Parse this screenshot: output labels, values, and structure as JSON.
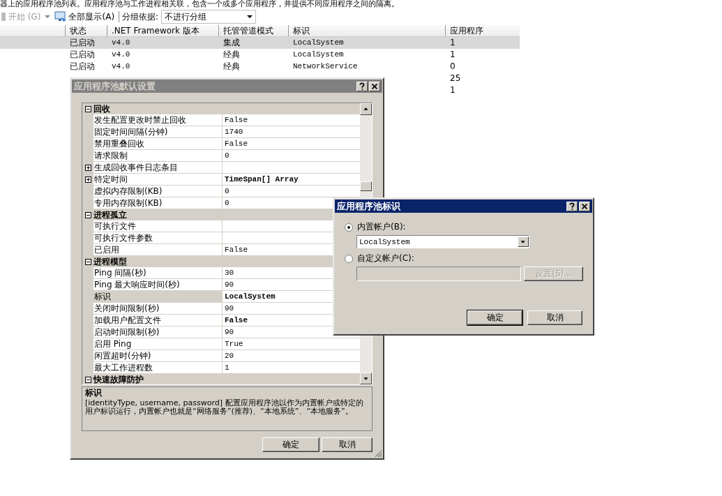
{
  "description_line": "器上的应用程序池列表。应用程序池与工作进程相关联，包含一个或多个应用程序，并提供不同应用程序之间的隔离。",
  "toolbar": {
    "items": [
      {
        "kind": "start",
        "label": "开始 (G)",
        "disabled": true
      },
      {
        "kind": "show-all",
        "label": "全部显示(A)",
        "disabled": false
      }
    ],
    "group_label": "分组依据:",
    "group_value": "不进行分组"
  },
  "table": {
    "columns": [
      "状态",
      ".NET Framework 版本",
      "托管管道模式",
      "标识",
      "应用程序"
    ],
    "rows": [
      {
        "cells": [
          "已启动",
          "v4.0",
          "集成",
          "LocalSystem",
          "1"
        ],
        "selected": true
      },
      {
        "cells": [
          "已启动",
          "v4.0",
          "经典",
          "LocalSystem",
          "1"
        ],
        "selected": false
      },
      {
        "cells": [
          "已启动",
          "v4.0",
          "经典",
          "NetworkService",
          "0"
        ],
        "selected": false
      },
      {
        "apps": "25",
        "selected": false
      },
      {
        "apps": "1",
        "selected": false
      }
    ]
  },
  "defaults_dialog": {
    "title": "应用程序池默认设置",
    "active": false,
    "categories": [
      {
        "name": "回收",
        "expanded": true,
        "items": [
          {
            "name": "发生配置更改时禁止回收",
            "value": "False",
            "selected": false
          },
          {
            "name": "固定时间间隔(分钟)",
            "value": "1740",
            "selected": false
          },
          {
            "name": "禁用重叠回收",
            "value": "False",
            "selected": false
          },
          {
            "name": "请求限制",
            "value": "0",
            "selected": false
          },
          {
            "name": "生成回收事件日志条目",
            "expandable": true,
            "selected": false
          },
          {
            "name": "特定时间",
            "value": "TimeSpan[] Array",
            "bold": true,
            "expandable": true,
            "selected": false
          },
          {
            "name": "虚拟内存限制(KB)",
            "value": "0",
            "selected": false
          },
          {
            "name": "专用内存限制(KB)",
            "value": "0",
            "selected": false
          }
        ]
      },
      {
        "name": "进程孤立",
        "expanded": true,
        "items": [
          {
            "name": "可执行文件",
            "selected": false
          },
          {
            "name": "可执行文件参数",
            "selected": false
          },
          {
            "name": "已启用",
            "value": "False",
            "selected": false
          }
        ]
      },
      {
        "name": "进程模型",
        "expanded": true,
        "items": [
          {
            "name": "Ping 间隔(秒)",
            "value": "30",
            "selected": false
          },
          {
            "name": "Ping 最大响应时间(秒)",
            "value": "90",
            "selected": false
          },
          {
            "name": "标识",
            "value": "LocalSystem",
            "bold": true,
            "selected": true
          },
          {
            "name": "关闭时间限制(秒)",
            "value": "90",
            "selected": false
          },
          {
            "name": "加载用户配置文件",
            "value": "False",
            "bold": true,
            "selected": false
          },
          {
            "name": "启动时间限制(秒)",
            "value": "90",
            "selected": false
          },
          {
            "name": "启用 Ping",
            "value": "True",
            "selected": false
          },
          {
            "name": "闲置超时(分钟)",
            "value": "20",
            "selected": false
          },
          {
            "name": "最大工作进程数",
            "value": "1",
            "selected": false
          }
        ]
      },
      {
        "name": "快速故障防护",
        "expanded": true
      }
    ],
    "help_title": "标识",
    "help_text": "[identityType, username, password] 配置应用程序池以作为内置帐户或特定的用户标识运行，内置帐户也就是“网络服务”(推荐)、“本地系统”、“本地服务”。",
    "buttons": [
      "确定",
      "取消"
    ]
  },
  "identity_dialog": {
    "title": "应用程序池标识",
    "active": true,
    "options": [
      {
        "label": "内置帐户(B):",
        "selected": true
      },
      {
        "label": "自定义帐户(C):",
        "selected": false
      }
    ],
    "builtin_value": "LocalSystem",
    "set_button": {
      "label": "设置(S)...",
      "disabled": true
    },
    "buttons": [
      "确定",
      "取消"
    ]
  }
}
